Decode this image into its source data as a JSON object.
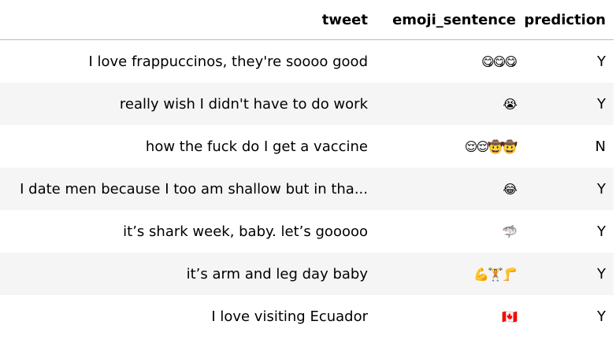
{
  "headers": {
    "tweet": "tweet",
    "emoji_sentence": "emoji_sentence",
    "prediction": "prediction"
  },
  "rows": [
    {
      "tweet": "I love frappuccinos, they're soooo good",
      "emoji_sentence": "😋😋😋",
      "prediction": "Y"
    },
    {
      "tweet": "really wish I didn't have to do work",
      "emoji_sentence": "😭",
      "prediction": "Y"
    },
    {
      "tweet": "how the fuck do I get a vaccine",
      "emoji_sentence": "😌😌🤠🤠",
      "prediction": "N"
    },
    {
      "tweet": "I date men because I too am shallow but in tha...",
      "emoji_sentence": "😂",
      "prediction": "Y"
    },
    {
      "tweet": "it’s shark week, baby. let’s gooooo",
      "emoji_sentence": "🦈",
      "prediction": "Y"
    },
    {
      "tweet": "it’s arm and leg day baby",
      "emoji_sentence": "💪🏋🦵",
      "prediction": "Y"
    },
    {
      "tweet": "I love visiting Ecuador",
      "emoji_sentence": "🇨🇦",
      "prediction": "Y"
    }
  ]
}
